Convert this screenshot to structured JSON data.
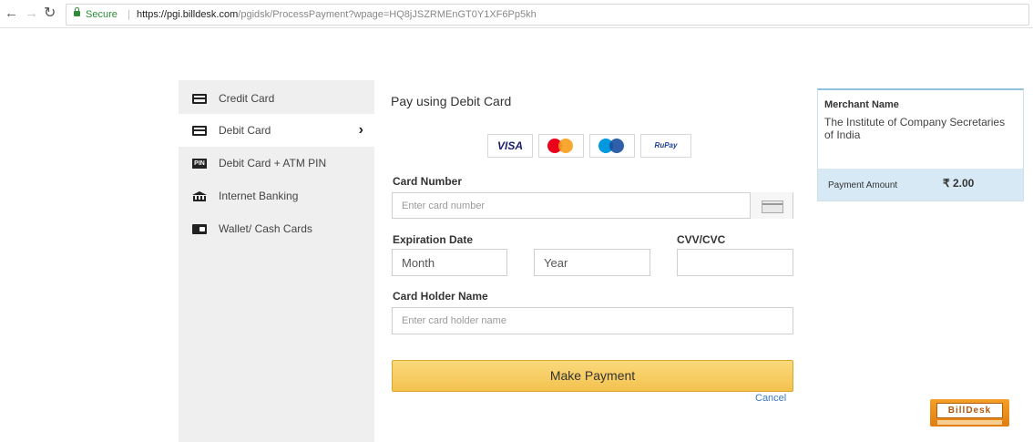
{
  "browser": {
    "secure_label": "Secure",
    "url_host": "https://pgi.billdesk.com",
    "url_path": "/pgidsk/ProcessPayment?wpage=HQ8jJSZRMEnGT0Y1XF6Pp5kh"
  },
  "payment_methods": [
    {
      "label": "Credit Card",
      "icon": "credit-card-icon",
      "active": false
    },
    {
      "label": "Debit Card",
      "icon": "debit-card-icon",
      "active": true
    },
    {
      "label": "Debit Card + ATM PIN",
      "icon": "pin-icon",
      "active": false
    },
    {
      "label": "Internet Banking",
      "icon": "bank-icon",
      "active": false
    },
    {
      "label": "Wallet/ Cash Cards",
      "icon": "wallet-icon",
      "active": false
    }
  ],
  "form": {
    "title": "Pay using Debit Card",
    "card_brands": [
      "VISA",
      "Mastercard",
      "Maestro",
      "RuPay"
    ],
    "visa_text": "VISA",
    "rupay_text": "RuPay",
    "card_number_label": "Card Number",
    "card_number_placeholder": "Enter card number",
    "expiration_label": "Expiration Date",
    "month_placeholder": "Month",
    "year_placeholder": "Year",
    "cvv_label": "CVV/CVC",
    "cvv_placeholder": "",
    "holder_label": "Card Holder Name",
    "holder_placeholder": "Enter card holder name",
    "submit_label": "Make Payment",
    "cancel_label": "Cancel"
  },
  "merchant": {
    "title": "Merchant Name",
    "name": "The Institute of Company Secretaries of India",
    "amount_label": "Payment Amount",
    "amount_value": "₹ 2.00"
  },
  "branding": {
    "logo_text": "BillDesk"
  },
  "colors": {
    "button": "#f3c24e",
    "link": "#3a78c2",
    "secure": "#2e8b3a",
    "amount_strip": "#d7e9f4"
  }
}
